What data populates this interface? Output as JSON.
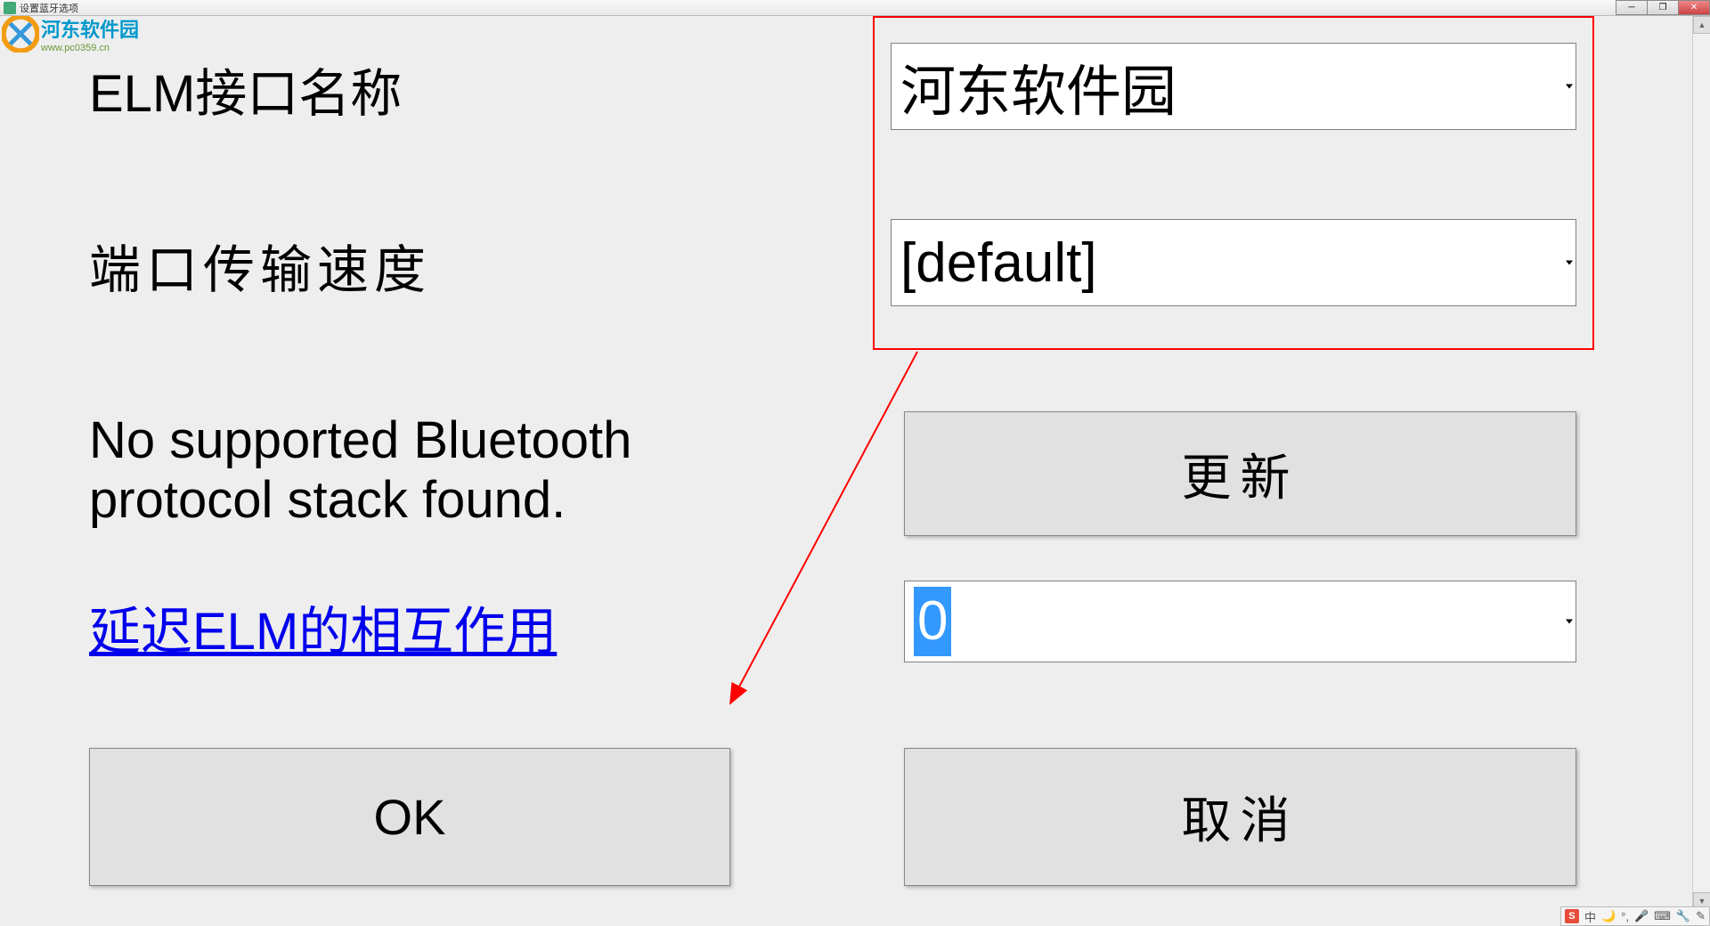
{
  "window": {
    "title": "设置蓝牙选项",
    "icon_name": "app-icon"
  },
  "watermark": {
    "text_cn": "河东软件园",
    "url": "www.pc0359.cn"
  },
  "labels": {
    "elm_interface": "ELM接口名称",
    "port_speed": "端口传输速度",
    "status": "No supported Bluetooth protocol stack found.",
    "delay_link": "延迟ELM的相互作用"
  },
  "dropdowns": {
    "elm_value": "河东软件园",
    "baud_value": "[default]",
    "delay_value": "0"
  },
  "buttons": {
    "update": "更新",
    "ok": "OK",
    "cancel": "取消"
  },
  "ime": {
    "logo": "S",
    "lang": "中",
    "icons": [
      "moon",
      "punct",
      "mic",
      "keyboard",
      "wrench",
      "pen"
    ]
  }
}
